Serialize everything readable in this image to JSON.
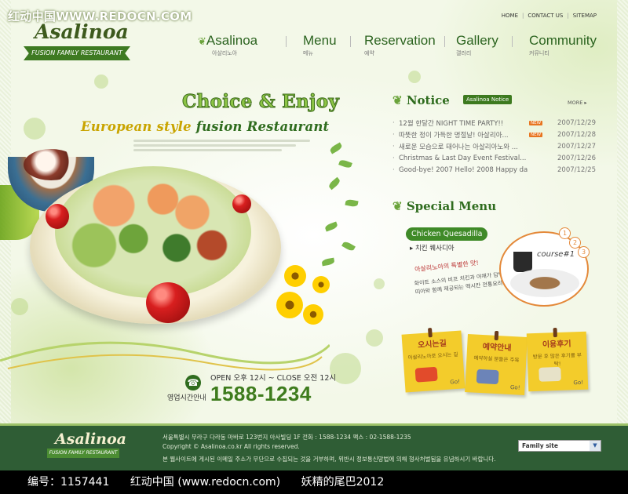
{
  "watermark": "红动中国WWW.REDOCN.COM",
  "logo": {
    "name": "Asalinoa",
    "tagline": "FUSION FAMILY RESTAURANT"
  },
  "util_links": [
    "HOME",
    "CONTACT US",
    "SITEMAP"
  ],
  "nav": [
    {
      "label": "Asalinoa",
      "sub": "아살리노아"
    },
    {
      "label": "Menu",
      "sub": "메뉴"
    },
    {
      "label": "Reservation",
      "sub": "예약"
    },
    {
      "label": "Gallery",
      "sub": "갤러리"
    },
    {
      "label": "Community",
      "sub": "커뮤니티"
    }
  ],
  "hero": {
    "headline": "Choice & Enjoy",
    "subheadline_a": "European style ",
    "subheadline_b": "fusion Restaurant"
  },
  "hours": {
    "open_text": "OPEN 오후 12시 ~ CLOSE 오전 12시",
    "label": "영업시간안내",
    "phone": "1588-1234"
  },
  "notice": {
    "title": "Notice",
    "tab": "Asalinoa Notice",
    "more": "MORE ▸",
    "new_badge": "NEW",
    "items": [
      {
        "text": "12월 한달간 NIGHT TIME PARTY!!",
        "date": "2007/12/29",
        "new": true
      },
      {
        "text": "따뜻한 정이 가득한 명절날! 아살리아...",
        "date": "2007/12/28",
        "new": true
      },
      {
        "text": "새로운 모습으로 태어나는 아살리아노와 ...",
        "date": "2007/12/27",
        "new": false
      },
      {
        "text": "Christmas & Last Day Event Festival...",
        "date": "2007/12/26",
        "new": false
      },
      {
        "text": "Good-bye! 2007 Hello! 2008 Happy day...",
        "date": "2007/12/25",
        "new": false
      }
    ]
  },
  "special": {
    "title": "Special Menu",
    "item_en": "Chicken Quesadilla",
    "item_ko": "▸ 치킨 퀘사디아",
    "handwritten_title": "아살리노아의 특별한 맛!",
    "handwritten_desc": "화이트 소스의 비프 치킨과 야채가 담백한 또띠아와 함께 제공되는 멕시칸 전통요리.",
    "course_label": "course#1",
    "course_numbers": [
      "1",
      "2",
      "3"
    ]
  },
  "notes": [
    {
      "title": "오시는길",
      "sub": "아살리노아로 오시는 길",
      "go": "Go!"
    },
    {
      "title": "예약안내",
      "sub": "예약하실 분들은 주목",
      "go": "Go!"
    },
    {
      "title": "이용후기",
      "sub": "방문 후 많은 후기를 부탁!",
      "go": "Go!"
    }
  ],
  "footer": {
    "logo": "Asalinoa",
    "tagline": "FUSION FAMILY RESTAURANT",
    "address": "서울특별시 무라구 다라동 마바로 123번지 아사빌딩 1F  전화 : 1588-1234  팩스 : 02-1588-1235",
    "copyright": "Copyright © Asalinoa.co.kr All rights reserved.",
    "notice": "본 웹사이트에 게시된 이메일 주소가 무단으로 수집되는 것을 거부하며, 위반시 정보통신망법에 의해 형사처벌됨을 유념하시기 바랍니다.",
    "family_site": "Family site"
  },
  "band": {
    "id_text": "编号：1157441",
    "site_text": "红动中国 (www.redocn.com)",
    "author_text": "妖精的尾巴2012"
  },
  "colors": {
    "primary_green": "#2f6c1e",
    "footer_green": "#2f5d35",
    "accent_orange": "#e4893a",
    "note_yellow": "#f3cc2b"
  }
}
